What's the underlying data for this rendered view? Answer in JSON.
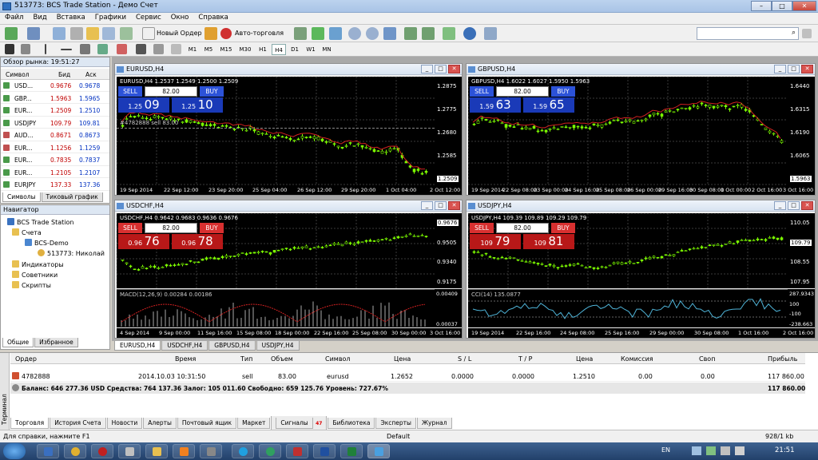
{
  "window": {
    "title": "513773: BCS Trade Station - Демо Счет",
    "btn_min": "–",
    "btn_max": "□",
    "btn_close": "✕"
  },
  "menu": [
    "Файл",
    "Вид",
    "Вставка",
    "Графики",
    "Сервис",
    "Окно",
    "Справка"
  ],
  "toolbar": {
    "new_order": "Новый Ордер",
    "autotrading": "Авто-торговля",
    "timeframes": [
      "M1",
      "M5",
      "M15",
      "M30",
      "H1",
      "H4",
      "D1",
      "W1",
      "MN"
    ],
    "active_timeframe": "H4",
    "search_placeholder": ""
  },
  "market_watch": {
    "title": "Обзор рынка: 19:51:27",
    "headers": {
      "symbol": "Символ",
      "bid": "Бид",
      "ask": "Аск"
    },
    "rows": [
      {
        "symbol": "USD...",
        "bid": "0.9676",
        "ask": "0.9678"
      },
      {
        "symbol": "GBP...",
        "bid": "1.5963",
        "ask": "1.5965"
      },
      {
        "symbol": "EUR...",
        "bid": "1.2509",
        "ask": "1.2510"
      },
      {
        "symbol": "USDJPY",
        "bid": "109.79",
        "ask": "109.81"
      },
      {
        "symbol": "AUD...",
        "bid": "0.8671",
        "ask": "0.8673"
      },
      {
        "symbol": "EUR...",
        "bid": "1.1256",
        "ask": "1.1259"
      },
      {
        "symbol": "EUR...",
        "bid": "0.7835",
        "ask": "0.7837"
      },
      {
        "symbol": "EUR...",
        "bid": "1.2105",
        "ask": "1.2107"
      },
      {
        "symbol": "EURJPY",
        "bid": "137.33",
        "ask": "137.36"
      }
    ],
    "tabs": [
      "Символы",
      "Тиковый график"
    ]
  },
  "navigator": {
    "title": "Навигатор",
    "items": [
      "BCS Trade Station",
      "Счета",
      "BCS-Demo",
      "513773: Николай",
      "Индикаторы",
      "Советники",
      "Скрипты"
    ],
    "tabs": [
      "Общие",
      "Избранное"
    ]
  },
  "charts": [
    {
      "title": "EURUSD,H4",
      "ohlc": "EURUSD,H4  1.2537 1.2549 1.2500 1.2509",
      "sell": "SELL",
      "buy": "BUY",
      "lot": "82.00",
      "bid_small": "1.25",
      "bid_big": "09",
      "ask_small": "1.25",
      "ask_big": "10",
      "theme": "blue",
      "prices": [
        "1.2875",
        "1.2775",
        "1.2680",
        "1.2585",
        "1.2509"
      ],
      "current": "1.2509",
      "times": [
        "19 Sep 2014",
        "22 Sep 12:00",
        "23 Sep 20:00",
        "25 Sep 04:00",
        "26 Sep 12:00",
        "29 Sep 20:00",
        "1 Oct 04:00",
        "2 Oct 12:00"
      ],
      "order_line": "#4782888 sell 83.00"
    },
    {
      "title": "GBPUSD,H4",
      "ohlc": "GBPUSD,H4  1.6022 1.6027 1.5950 1.5963",
      "sell": "SELL",
      "buy": "BUY",
      "lot": "82.00",
      "bid_small": "1.59",
      "bid_big": "63",
      "ask_small": "1.59",
      "ask_big": "65",
      "theme": "blue",
      "prices": [
        "1.6440",
        "1.6315",
        "1.6190",
        "1.6065",
        "1.5963"
      ],
      "current": "1.5963",
      "times": [
        "19 Sep 2014",
        "22 Sep 08:00",
        "23 Sep 00:00",
        "24 Sep 16:00",
        "25 Sep 08:00",
        "26 Sep 00:00",
        "29 Sep 16:00",
        "30 Sep 08:00",
        "1 Oct 00:00",
        "2 Oct 16:00",
        "3 Oct 16:00"
      ]
    },
    {
      "title": "USDCHF,H4",
      "ohlc": "USDCHF,H4  0.9642 0.9683 0.9636 0.9676",
      "sell": "SELL",
      "buy": "BUY",
      "lot": "82.00",
      "bid_small": "0.96",
      "bid_big": "76",
      "ask_small": "0.96",
      "ask_big": "78",
      "theme": "red",
      "prices": [
        "0.9676",
        "0.9505",
        "0.9340",
        "0.9175"
      ],
      "current": "0.9676",
      "times": [
        "4 Sep 2014",
        "9 Sep 00:00",
        "11 Sep 16:00",
        "15 Sep 08:00",
        "18 Sep 00:00",
        "22 Sep 16:00",
        "25 Sep 08:00",
        "30 Sep 00:00",
        "3 Oct 16:00"
      ],
      "indicator": "MACD(12,26,9) 0.00284 0.00186",
      "ind_prices": [
        "0.00409",
        "0.00037"
      ]
    },
    {
      "title": "USDJPY,H4",
      "ohlc": "USDJPY,H4  109.39 109.89 109.29 109.79",
      "sell": "SELL",
      "buy": "BUY",
      "lot": "82.00",
      "bid_small": "109",
      "bid_big": "79",
      "ask_small": "109",
      "ask_big": "81",
      "theme": "red",
      "prices": [
        "110.05",
        "109.79",
        "108.55",
        "107.95"
      ],
      "current": "109.79",
      "times": [
        "19 Sep 2014",
        "22 Sep 16:00",
        "24 Sep 08:00",
        "25 Sep 16:00",
        "29 Sep 00:00",
        "30 Sep 08:00",
        "1 Oct 16:00",
        "2 Oct 16:00"
      ],
      "indicator": "CCI(14) 135.0877",
      "ind_prices": [
        "287.9343",
        "100",
        "-100",
        "-238.663"
      ]
    }
  ],
  "chart_tabs": [
    "EURUSD,H4",
    "USDCHF,H4",
    "GBPUSD,H4",
    "USDJPY,H4"
  ],
  "terminal": {
    "side_label": "Терминал",
    "headers": [
      "Ордер",
      "Время",
      "Тип",
      "Объем",
      "Символ",
      "Цена",
      "S / L",
      "T / P",
      "Цена",
      "Комиссия",
      "Своп",
      "Прибыль"
    ],
    "row": [
      "4782888",
      "2014.10.03 10:31:50",
      "sell",
      "83.00",
      "eurusd",
      "1.2652",
      "0.0000",
      "0.0000",
      "1.2510",
      "0.00",
      "0.00",
      "117 860.00"
    ],
    "balance": "Баланс: 646 277.36 USD  Средства: 764 137.36  Залог: 105 011.60  Свободно: 659 125.76  Уровень: 727.67%",
    "balance_profit": "117 860.00",
    "tabs": [
      "Торговля",
      "История Счета",
      "Новости",
      "Алерты",
      "Почтовый ящик",
      "Маркет",
      "Сигналы",
      "Библиотека",
      "Эксперты",
      "Журнал"
    ],
    "signals_badge": "47"
  },
  "status": {
    "help": "Для справки, нажмите F1",
    "profile": "Default",
    "traffic": "928/1 kb"
  },
  "taskbar": {
    "lang": "EN",
    "clock": "21:51"
  }
}
